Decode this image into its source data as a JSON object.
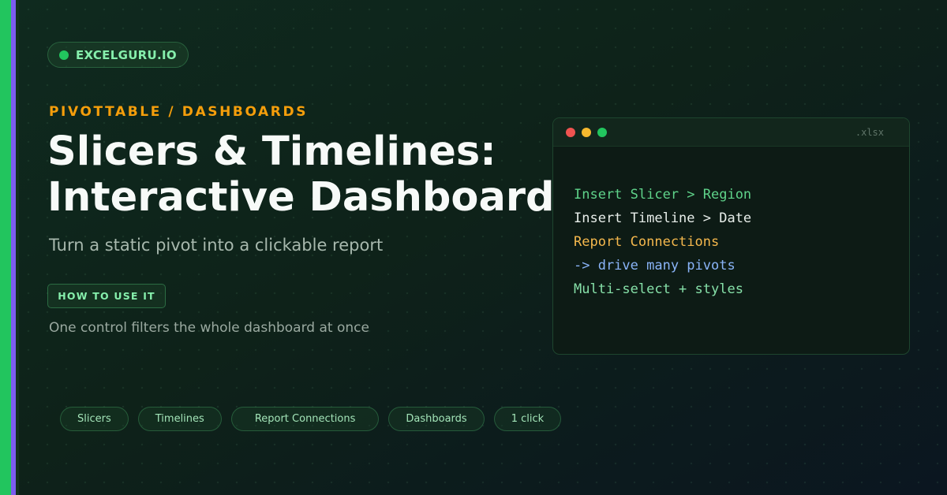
{
  "brand": {
    "label": "EXCELGURU.IO",
    "dot_color": "#22c55e"
  },
  "hero": {
    "eyebrow": "PIVOTTABLE / DASHBOARDS",
    "title_line1": "Slicers & Timelines:",
    "title_line2": "Interactive Dashboards",
    "subtitle": "Turn a static pivot into a clickable report",
    "cta_label": "HOW TO USE IT",
    "description": "One control filters the whole dashboard at once"
  },
  "code_window": {
    "file_ext": ".xlsx",
    "lines": [
      {
        "text": "Insert Slicer > Region",
        "color": "#5fd38a"
      },
      {
        "text": "Insert Timeline > Date",
        "color": "#e8eeea"
      },
      {
        "text": "Report Connections",
        "color": "#f5b84d"
      },
      {
        "text": "-> drive many pivots",
        "color": "#8ab4f8"
      },
      {
        "text": "Multi-select + styles",
        "color": "#86e0a8"
      }
    ]
  },
  "tags": [
    "Slicers",
    "Timelines",
    "Report Connections",
    "Dashboards",
    "1 click"
  ],
  "colors": {
    "accent_green": "#22c55e",
    "accent_purple": "#7c5cf0",
    "eyebrow_orange": "#f59e0b",
    "background": "#0f2a1f"
  }
}
